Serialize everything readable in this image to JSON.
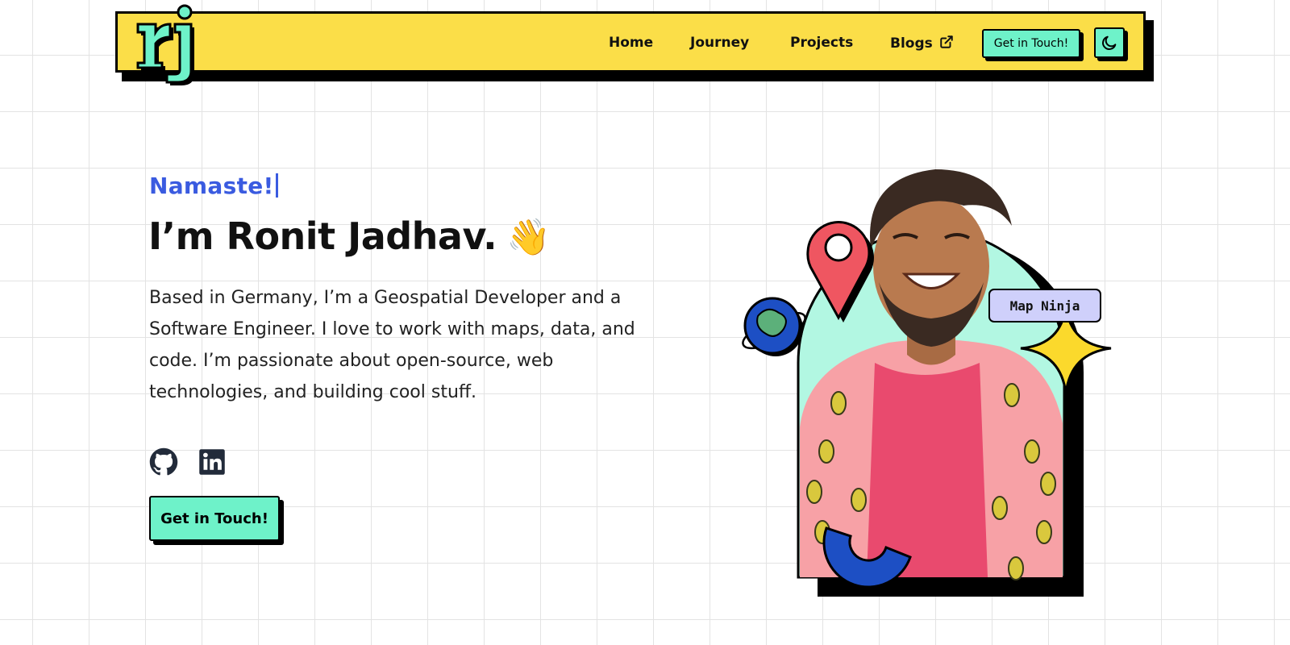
{
  "header": {
    "logo_text": "rj",
    "nav": [
      {
        "label": "Home"
      },
      {
        "label": "Journey"
      },
      {
        "label": "Projects"
      },
      {
        "label": "Blogs",
        "icon": "external-link-icon"
      }
    ],
    "cta_label": "Get in Touch!",
    "theme_icon": "moon-icon"
  },
  "hero": {
    "greeting": "Namaste!",
    "title": "I’m Ronit Jadhav.",
    "emoji": "👋",
    "bio": "Based in Germany, I’m a Geospatial Developer and a Software Engineer. I love to work with maps, data, and code. I’m passionate about open-source, web technologies, and building cool stuff.",
    "social": [
      {
        "icon": "github-icon"
      },
      {
        "icon": "linkedin-icon"
      }
    ],
    "cta_label": "Get in Touch!"
  },
  "illustration": {
    "tag_label": "Map Ninja"
  },
  "colors": {
    "nav_bg": "#fbde48",
    "accent_mint": "#6ef2c9",
    "accent_blue": "#3a5be0",
    "tag_bg": "#cfd0fb",
    "arch_bg": "#b2f7e2",
    "pin_red": "#ef5661",
    "star_yellow": "#fbd92c",
    "shape_blue": "#1d4fc4"
  }
}
